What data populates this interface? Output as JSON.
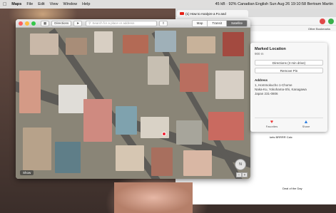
{
  "menubar": {
    "app": "Maps",
    "menus": [
      "File",
      "Edit",
      "View",
      "Window",
      "Help"
    ],
    "status": "45 kB  ·  92%  Canadian English  Sun Aug 26  19:10:58  Bertram Martin"
  },
  "browser": {
    "tab_title": "(1) How to Analyze a Fo and",
    "bookmarks_label": "Other Bookmarks",
    "side_text_1": "kets BRRRR Calc",
    "side_text_2": "Deal of the Day"
  },
  "maps": {
    "directions_label": "Directions",
    "search_placeholder": "Search for a place or address",
    "view_modes": [
      "Map",
      "Transit",
      "Satellite"
    ],
    "active_view": "Satellite",
    "show_label": "Show",
    "compass_label": "N"
  },
  "popover": {
    "title": "Marked Location",
    "distance": "900 m",
    "directions_button": "Directions (3 min drive)",
    "remove_pin_button": "Remove Pin",
    "address_heading": "Address",
    "address_lines": [
      "1, Hommokucho 1-Chome",
      "Naka-Ku, Yokohama-Shi, Kanagawa",
      "Japan 231-0806"
    ],
    "favorites_label": "Favorites",
    "share_label": "Share"
  }
}
